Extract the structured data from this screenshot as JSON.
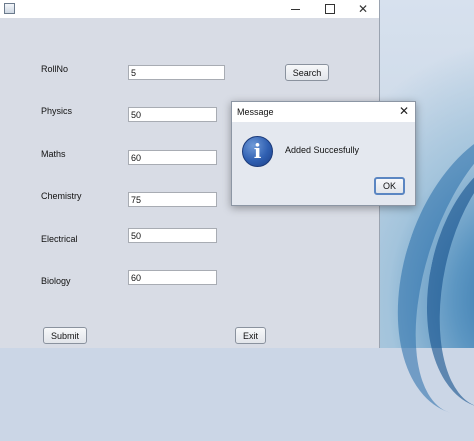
{
  "form": {
    "fields": [
      {
        "label": "RollNo",
        "value": "5"
      },
      {
        "label": "Physics",
        "value": "50"
      },
      {
        "label": "Maths",
        "value": "60"
      },
      {
        "label": "Chemistry",
        "value": "75"
      },
      {
        "label": "Electrical",
        "value": "50"
      },
      {
        "label": "Biology",
        "value": "60"
      }
    ],
    "search_label": "Search",
    "submit_label": "Submit",
    "exit_label": "Exit"
  },
  "dialog": {
    "title": "Message",
    "message": "Added Succesfully",
    "ok_label": "OK",
    "close_glyph": "✕",
    "icon": "info-icon",
    "icon_glyph": "i"
  },
  "window": {
    "close_glyph": "✕"
  }
}
